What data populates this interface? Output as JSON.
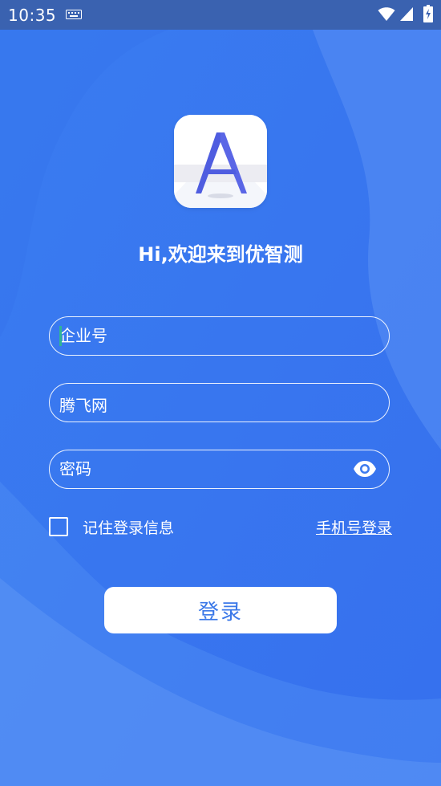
{
  "status_bar": {
    "time": "10:35"
  },
  "icons": {
    "keyboard": "keyboard-icon",
    "wifi": "wifi-icon",
    "signal": "cell-signal-icon",
    "battery": "battery-charging-icon",
    "logo": "app-logo-letter-a",
    "eye": "eye-icon"
  },
  "welcome": {
    "text": "Hi,欢迎来到优智测"
  },
  "form": {
    "company": {
      "placeholder": "企业号",
      "value": ""
    },
    "account": {
      "value": "腾飞网"
    },
    "password": {
      "placeholder": "密码",
      "value": ""
    },
    "remember": {
      "label": "记住登录信息",
      "checked": false
    },
    "phone_login_label": "手机号登录",
    "login_label": "登录"
  },
  "colors": {
    "background": "#3f7ef0",
    "status_bar": "#3a62b0",
    "button_text": "#3b78e8",
    "cursor": "#2fb596",
    "logo_letter": "#4f5de0"
  }
}
